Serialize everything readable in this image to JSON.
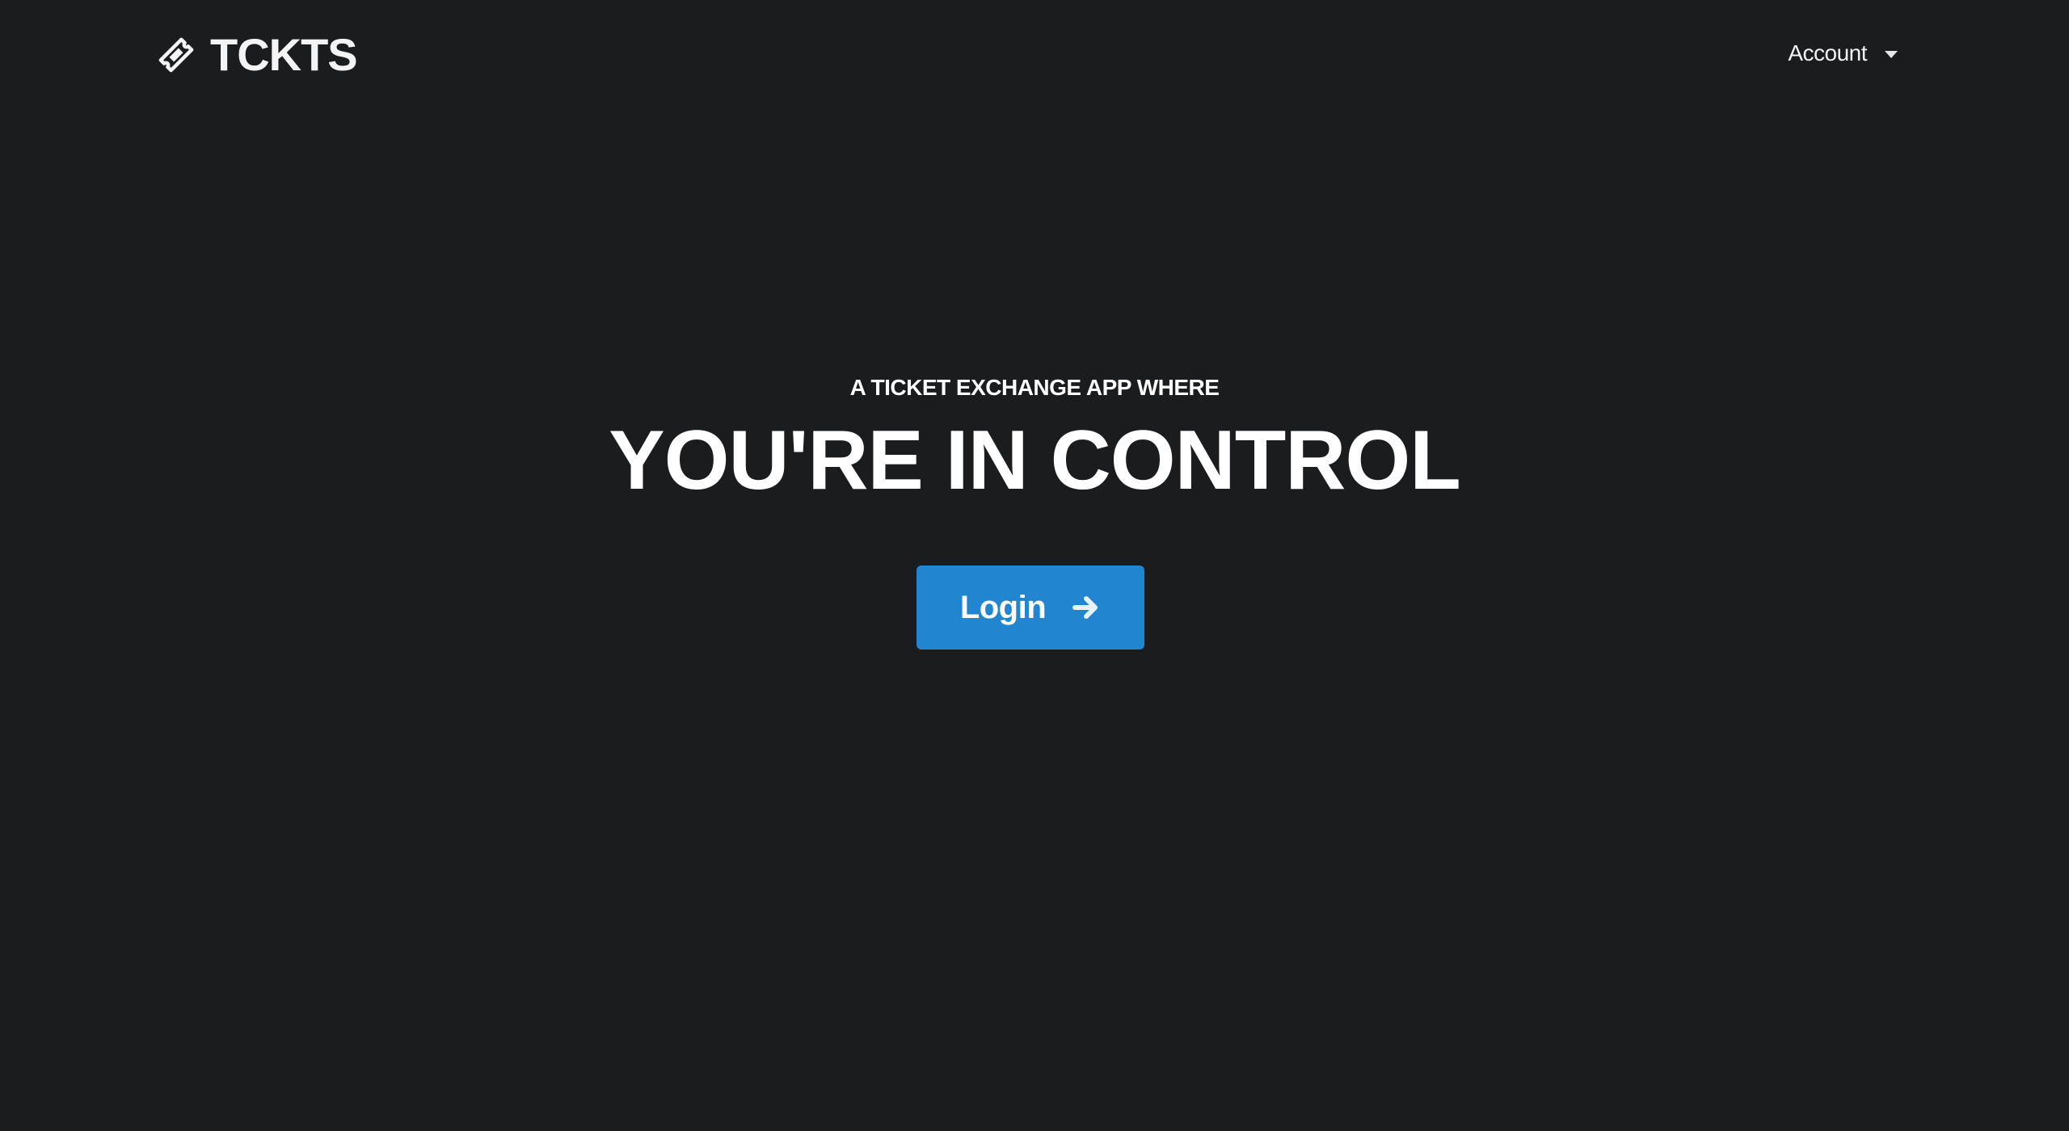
{
  "header": {
    "brand_name": "TCKTS",
    "brand_icon": "ticket-icon",
    "account_label": "Account",
    "account_icon": "caret-down-icon"
  },
  "hero": {
    "kicker": "A TICKET EXCHANGE APP WHERE",
    "title": "YOU'RE IN CONTROL",
    "login_label": "Login",
    "login_icon": "arrow-right-icon"
  },
  "colors": {
    "background": "#1b1c1e",
    "text": "#ffffff",
    "primary": "#2185d0"
  }
}
